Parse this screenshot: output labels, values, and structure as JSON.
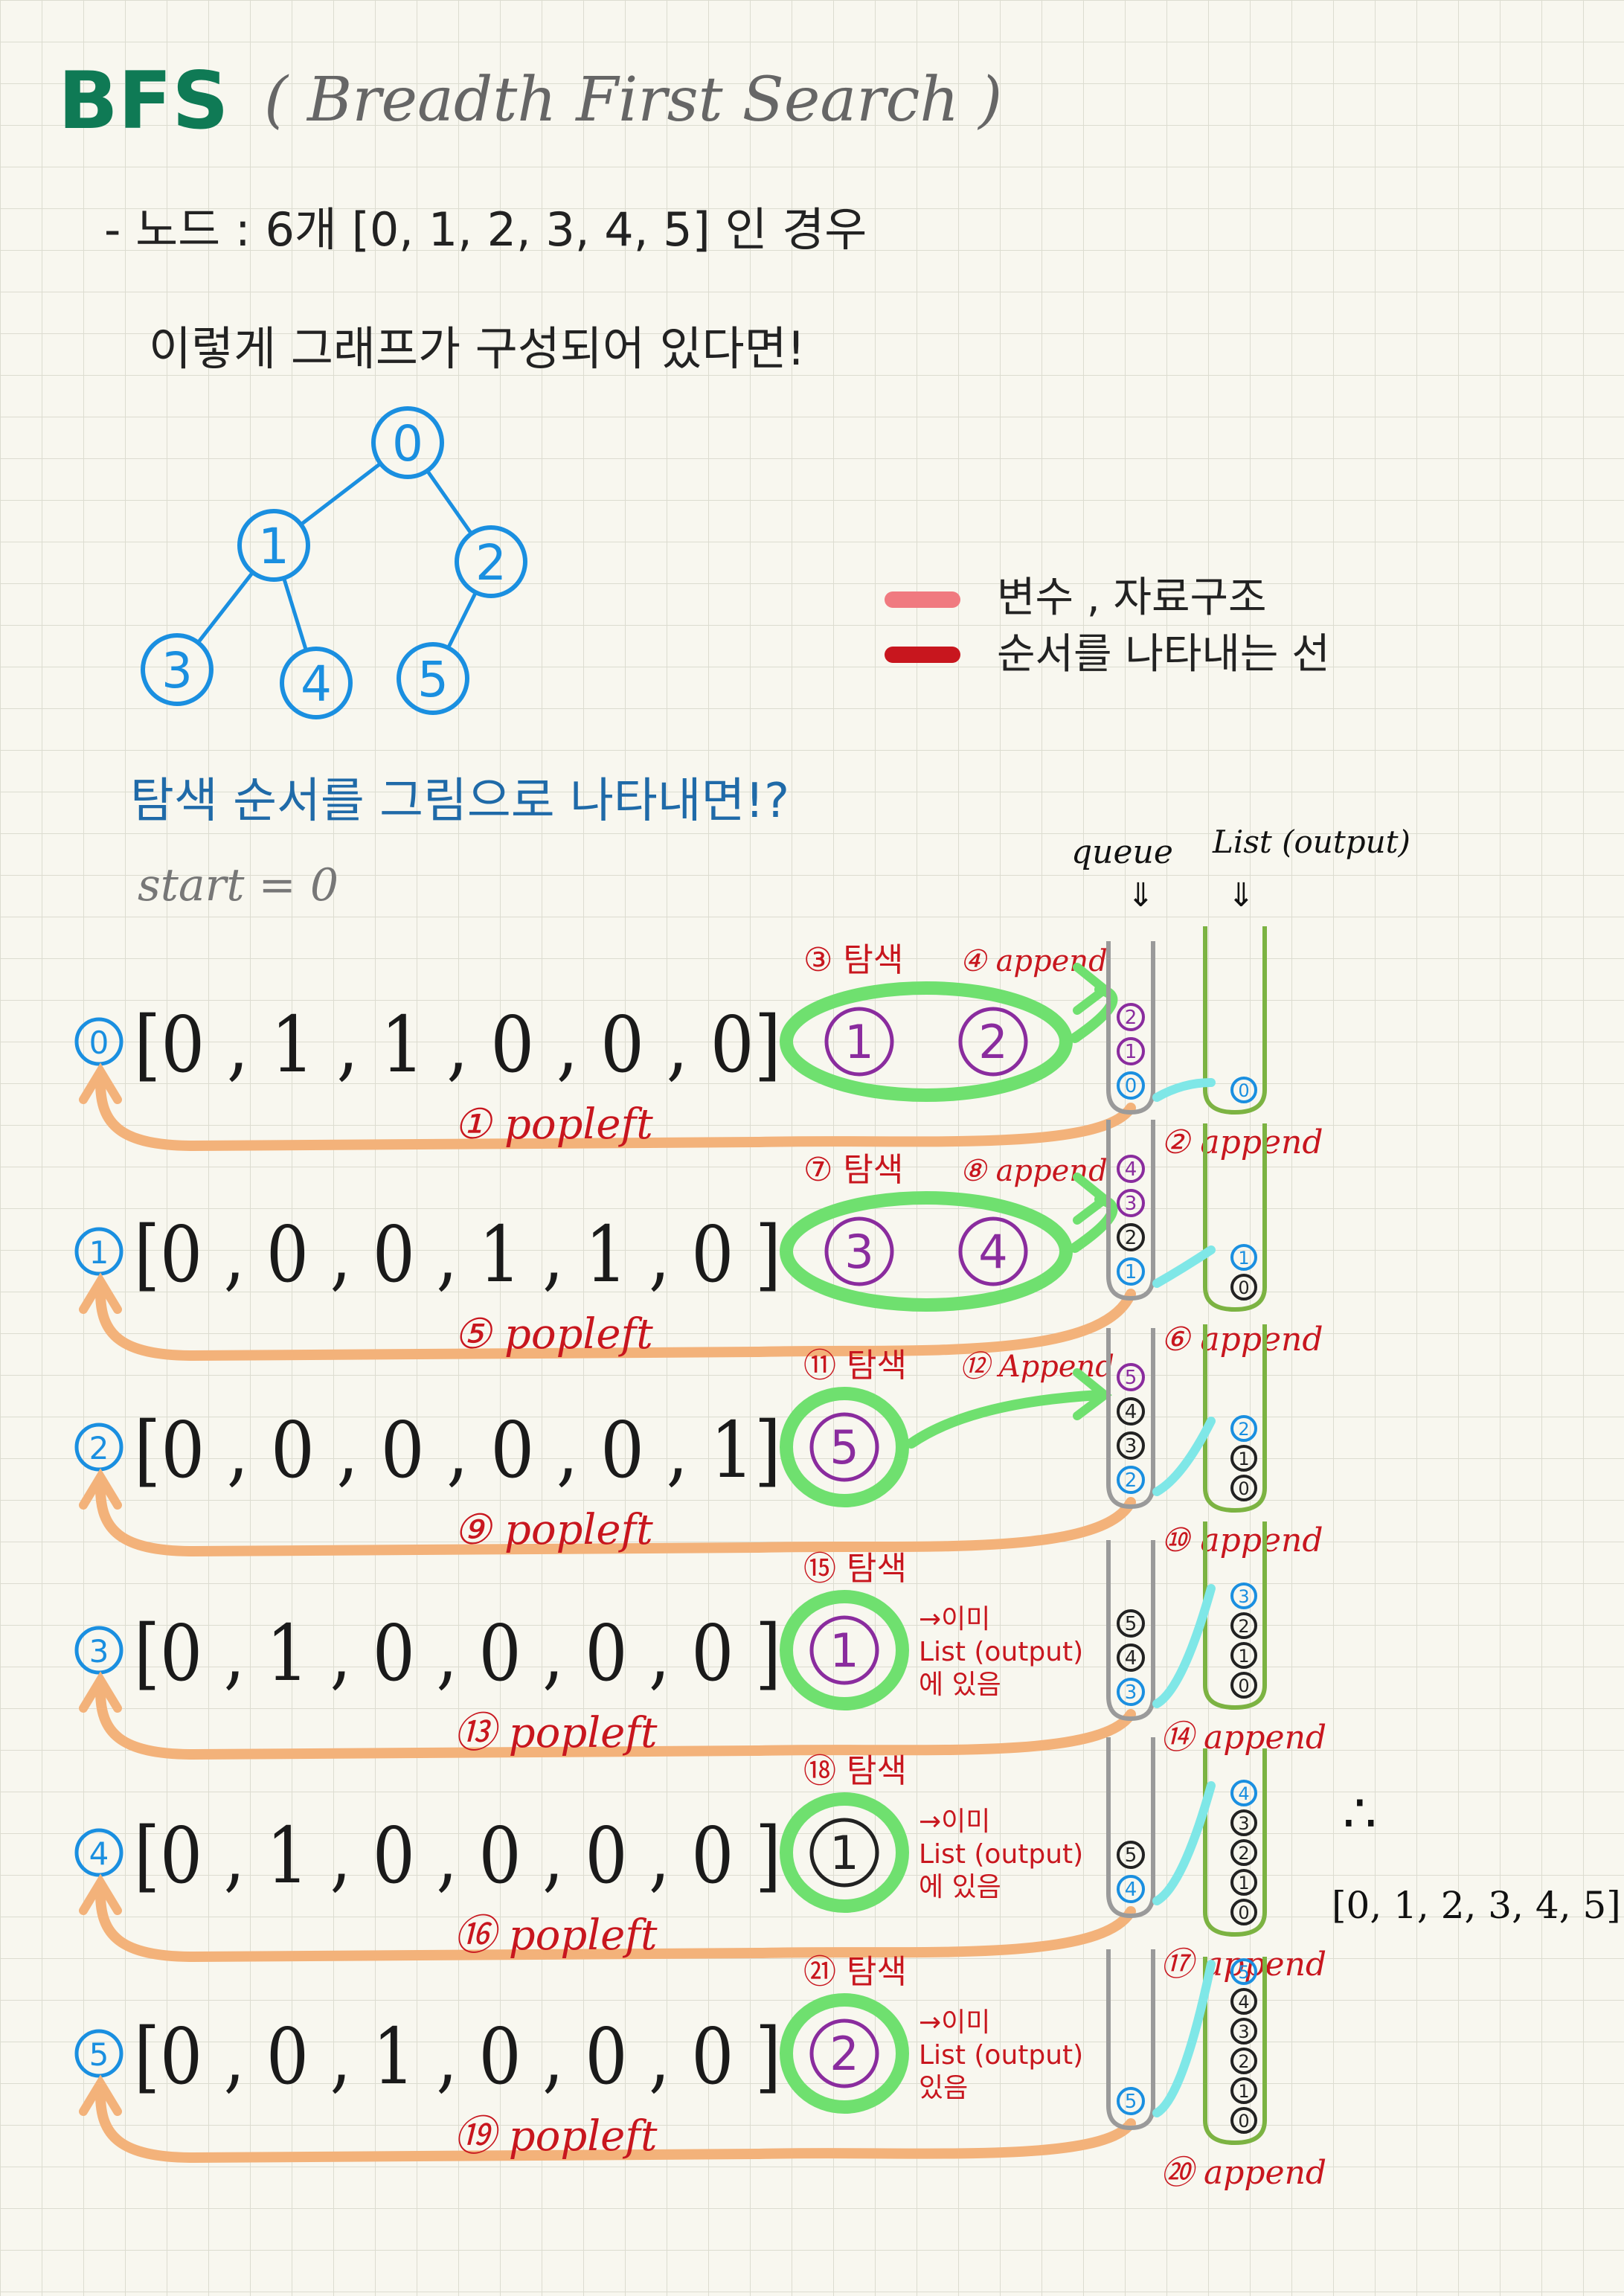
{
  "title": {
    "abbr": "BFS",
    "full": "( Breadth First Search )"
  },
  "intro": {
    "line1": "- 노드 : 6개  [0, 1, 2, 3, 4, 5]  인 경우",
    "line2": "이렇게 그래프가 구성되어 있다면!"
  },
  "graph": {
    "nodes": [
      "0",
      "1",
      "2",
      "3",
      "4",
      "5"
    ],
    "edges": [
      [
        "0",
        "1"
      ],
      [
        "0",
        "2"
      ],
      [
        "1",
        "3"
      ],
      [
        "1",
        "4"
      ],
      [
        "2",
        "5"
      ]
    ]
  },
  "legend": {
    "pink_label": "변수 , 자료구조",
    "red_label": "순서를 나타내는 선"
  },
  "section": {
    "title": "탐색 순서를 그림으로 나타내면!?",
    "start": "start = 0"
  },
  "columns": {
    "queue": "queue",
    "list": "List (output)"
  },
  "colors": {
    "blue": "#1a8fe0",
    "purple": "#8a2c9e",
    "red": "#c8161e",
    "green": "#6fe06f",
    "orange": "#f3b27a",
    "grey": "#9a9a9a",
    "olive": "#7cb342",
    "pink": "#f07a80",
    "teal": "#3a7aa8"
  },
  "rows": [
    {
      "node": "0",
      "matrix": "[0 , 1 , 1 , 0 , 0 , 0]",
      "explore": "③ 탐색",
      "append_q": "④ append",
      "found": [
        "1",
        "2"
      ],
      "note": "",
      "popleft": "① popleft",
      "append_out": "② append",
      "queue": [
        "2",
        "1",
        "0"
      ],
      "output": [
        "0"
      ]
    },
    {
      "node": "1",
      "matrix": "[0 , 0 , 0 , 1 , 1 , 0 ]",
      "explore": "⑦ 탐색",
      "append_q": "⑧ append",
      "found": [
        "3",
        "4"
      ],
      "note": "",
      "popleft": "⑤ popleft",
      "append_out": "⑥ append",
      "queue": [
        "4",
        "3",
        "2",
        "1"
      ],
      "output": [
        "1",
        "0"
      ]
    },
    {
      "node": "2",
      "matrix": "[0 , 0 , 0 , 0 , 0 , 1]",
      "explore": "⑪ 탐색",
      "append_q": "⑫ Append",
      "found": [
        "5"
      ],
      "note": "",
      "popleft": "⑨ popleft",
      "append_out": "⑩ append",
      "queue": [
        "5",
        "4",
        "3",
        "2"
      ],
      "output": [
        "2",
        "1",
        "0"
      ]
    },
    {
      "node": "3",
      "matrix": "[0 , 1 , 0 , 0 , 0 , 0 ]",
      "explore": "⑮ 탐색",
      "append_q": "",
      "found": [
        "1"
      ],
      "note": "→이미 List (output) 에 있음",
      "popleft": "⑬ popleft",
      "append_out": "⑭ append",
      "queue": [
        "5",
        "4",
        "3"
      ],
      "output": [
        "3",
        "2",
        "1",
        "0"
      ]
    },
    {
      "node": "4",
      "matrix": "[0 , 1 , 0 , 0 , 0 , 0 ]",
      "explore": "⑱ 탐색",
      "append_q": "",
      "found": [
        "1"
      ],
      "note": "→이미 List (output) 에 있음",
      "popleft": "⑯ popleft",
      "append_out": "⑰ append",
      "queue": [
        "5",
        "4"
      ],
      "output": [
        "4",
        "3",
        "2",
        "1",
        "0"
      ]
    },
    {
      "node": "5",
      "matrix": "[0 , 0 , 1 , 0 , 0 , 0 ]",
      "explore": "㉑ 탐색",
      "append_q": "",
      "found": [
        "2"
      ],
      "note": "→이미 List (output) 있음",
      "popleft": "⑲ popleft",
      "append_out": "⑳ append",
      "queue": [
        "5"
      ],
      "output": [
        "5",
        "4",
        "3",
        "2",
        "1",
        "0"
      ]
    }
  ],
  "result": {
    "therefore": "∴",
    "list": "[0, 1, 2, 3, 4, 5]"
  }
}
